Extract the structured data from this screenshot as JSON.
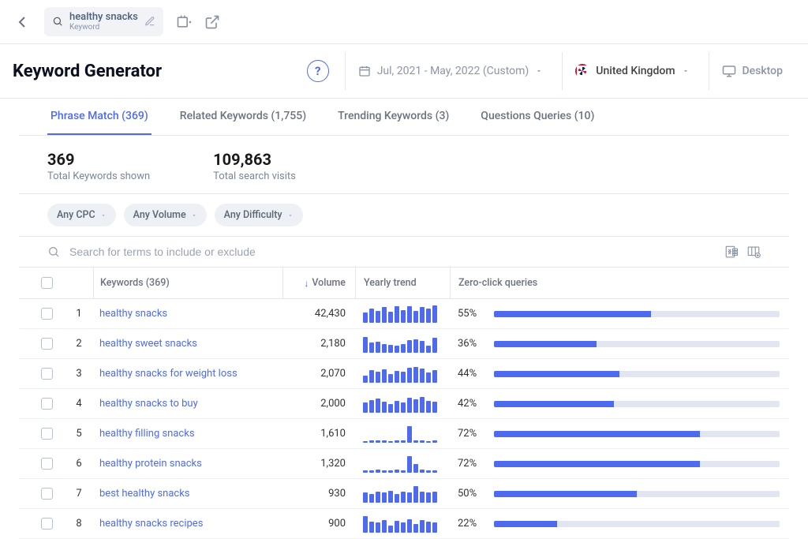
{
  "top": {
    "search_term": "healthy snacks",
    "search_sub": "Keyword"
  },
  "header": {
    "title": "Keyword Generator",
    "date_range": "Jul, 2021 - May, 2022 (Custom)",
    "country": "United Kingdom",
    "device": "Desktop"
  },
  "tabs": [
    {
      "label": "Phrase Match (369)",
      "active": true
    },
    {
      "label": "Related Keywords (1,755)",
      "active": false
    },
    {
      "label": "Trending Keywords (3)",
      "active": false
    },
    {
      "label": "Questions Queries (10)",
      "active": false
    }
  ],
  "summary": {
    "count_value": "369",
    "count_label": "Total Keywords shown",
    "visits_value": "109,863",
    "visits_label": "Total search visits"
  },
  "filters": {
    "cpc": "Any CPC",
    "volume": "Any Volume",
    "difficulty": "Any Difficulty"
  },
  "search": {
    "placeholder": "Search for terms to include or exclude"
  },
  "columns": {
    "keywords": "Keywords (369)",
    "volume": "Volume",
    "trend": "Yearly trend",
    "zero": "Zero-click queries"
  },
  "rows": [
    {
      "idx": "1",
      "kw": "healthy snacks",
      "vol": "42,430",
      "zc": "55%",
      "zc_pct": 55,
      "spark": [
        55,
        78,
        65,
        88,
        60,
        92,
        70,
        95,
        68,
        90,
        80,
        98
      ]
    },
    {
      "idx": "2",
      "kw": "healthy sweet snacks",
      "vol": "2,180",
      "zc": "36%",
      "zc_pct": 36,
      "spark": [
        90,
        55,
        60,
        50,
        45,
        40,
        48,
        70,
        75,
        65,
        40,
        85
      ]
    },
    {
      "idx": "3",
      "kw": "healthy snacks for weight loss",
      "vol": "2,070",
      "zc": "44%",
      "zc_pct": 44,
      "spark": [
        40,
        70,
        60,
        75,
        50,
        65,
        60,
        85,
        90,
        80,
        55,
        70
      ]
    },
    {
      "idx": "4",
      "kw": "healthy snacks to buy",
      "vol": "2,000",
      "zc": "42%",
      "zc_pct": 42,
      "spark": [
        55,
        70,
        80,
        60,
        50,
        65,
        55,
        85,
        75,
        90,
        65,
        60
      ]
    },
    {
      "idx": "5",
      "kw": "healthy filling snacks",
      "vol": "1,610",
      "zc": "72%",
      "zc_pct": 72,
      "spark": [
        8,
        10,
        12,
        10,
        8,
        12,
        10,
        95,
        12,
        10,
        8,
        10
      ]
    },
    {
      "idx": "6",
      "kw": "healthy protein snacks",
      "vol": "1,320",
      "zc": "72%",
      "zc_pct": 72,
      "spark": [
        10,
        12,
        14,
        10,
        12,
        15,
        12,
        95,
        50,
        14,
        12,
        10
      ]
    },
    {
      "idx": "7",
      "kw": "best healthy snacks",
      "vol": "930",
      "zc": "50%",
      "zc_pct": 50,
      "spark": [
        55,
        50,
        60,
        55,
        65,
        50,
        60,
        55,
        95,
        60,
        55,
        60
      ]
    },
    {
      "idx": "8",
      "kw": "healthy snacks recipes",
      "vol": "900",
      "zc": "22%",
      "zc_pct": 22,
      "spark": [
        95,
        60,
        55,
        70,
        40,
        65,
        55,
        75,
        50,
        70,
        60,
        55
      ]
    }
  ]
}
